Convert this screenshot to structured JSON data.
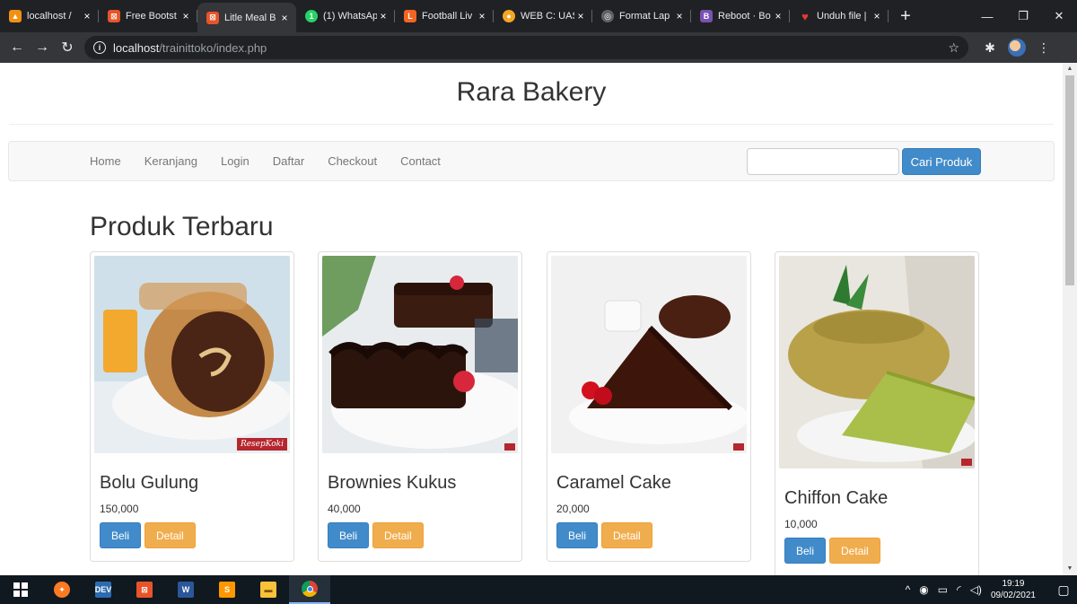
{
  "browser": {
    "tabs": [
      {
        "label": "localhost /",
        "favicon": "phpmyadmin-icon",
        "color": "#f29111",
        "glyph": "▲"
      },
      {
        "label": "Free Bootst",
        "favicon": "template-icon",
        "color": "#e8542a",
        "glyph": "⊠"
      },
      {
        "label": "Litle Meal B",
        "favicon": "template-icon",
        "color": "#e8542a",
        "glyph": "⊠",
        "active": true
      },
      {
        "label": "(1) WhatsAp",
        "favicon": "whatsapp-icon",
        "color": "#25d366",
        "glyph": "1"
      },
      {
        "label": "Football Liv",
        "favicon": "football-icon",
        "color": "#f26522",
        "glyph": "L"
      },
      {
        "label": "WEB C: UAS",
        "favicon": "moodle-icon",
        "color": "#f5a623",
        "glyph": "●"
      },
      {
        "label": "Format Lap",
        "favicon": "globe-icon",
        "color": "#9aa0a6",
        "glyph": "◎"
      },
      {
        "label": "Reboot · Bo",
        "favicon": "bootstrap-icon",
        "color": "#7952b3",
        "glyph": "B"
      },
      {
        "label": "Unduh file |",
        "favicon": "heart-icon",
        "color": "#e53935",
        "glyph": "♥"
      }
    ],
    "url_host": "localhost",
    "url_path": "/trainittoko/index.php"
  },
  "site": {
    "title": "Rara Bakery",
    "nav": [
      "Home",
      "Keranjang",
      "Login",
      "Daftar",
      "Checkout",
      "Contact"
    ],
    "search_placeholder": "",
    "search_button": "Cari Produk",
    "section_title": "Produk Terbaru"
  },
  "products": [
    {
      "name": "Bolu Gulung",
      "price": "150,000",
      "buy": "Beli",
      "detail": "Detail",
      "watermark": "ResepKoki"
    },
    {
      "name": "Brownies Kukus",
      "price": "40,000",
      "buy": "Beli",
      "detail": "Detail",
      "watermark": ""
    },
    {
      "name": "Caramel Cake",
      "price": "20,000",
      "buy": "Beli",
      "detail": "Detail",
      "watermark": ""
    },
    {
      "name": "Chiffon Cake",
      "price": "10,000",
      "buy": "Beli",
      "detail": "Detail",
      "watermark": ""
    }
  ],
  "taskbar": {
    "time": "19:19",
    "date": "09/02/2021"
  },
  "colors": {
    "primary": "#428bca",
    "warning": "#f0ad4e"
  }
}
